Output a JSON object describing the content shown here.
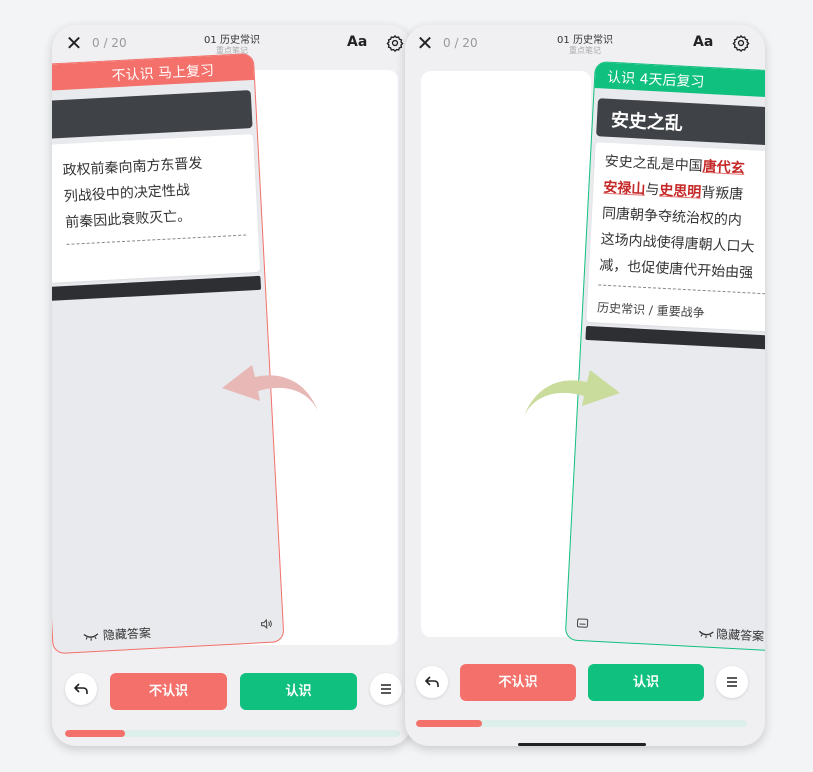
{
  "screens": [
    {
      "topbar": {
        "close_icon": "close-icon",
        "counter": "0 / 20",
        "deck_title": "01 历史常识",
        "deck_subtitle": "重点笔记",
        "font_label": "Aa",
        "settings_icon": "gear-icon"
      },
      "card": {
        "status": "不认识 马上复习",
        "accent_color": "#f4706a",
        "term": "",
        "definition_lines": [
          "政权前秦向南方东晋发",
          "列战役中的决定性战",
          "前秦因此衰败灭亡。"
        ],
        "hide_answer_label": "隐藏答案",
        "hide_icon": "closed-eye-icon",
        "sound_icon": "speaker-icon"
      },
      "swipe_icon": "swipe-left-arrow-icon",
      "bottom": {
        "undo_icon": "undo-icon",
        "unknown_label": "不认识",
        "known_label": "认识",
        "menu_icon": "menu-icon",
        "progress": 0.18
      }
    },
    {
      "topbar": {
        "close_icon": "close-icon",
        "counter": "0 / 20",
        "deck_title": "01 历史常识",
        "deck_subtitle": "重点笔记",
        "font_label": "Aa",
        "settings_icon": "gear-icon"
      },
      "card": {
        "status": "认识 4天后复习",
        "accent_color": "#10c07f",
        "term": "安史之乱",
        "definition": {
          "line1_prefix": "安史之乱是中国",
          "line1_highlight": "唐代玄",
          "line2_hl1": "安禄山",
          "line2_mid": "与",
          "line2_hl2": "史思明",
          "line2_suffix": "背叛唐",
          "line3": "同唐朝争夺统治权的内",
          "line4": "这场内战使得唐朝人口大",
          "line5": "减，也促使唐代开始由强"
        },
        "tag": "历史常识 / 重要战争",
        "hide_answer_label": "隐藏答案",
        "hide_icon": "closed-eye-icon",
        "card_icon": "card-icon"
      },
      "swipe_icon": "swipe-right-arrow-icon",
      "bottom": {
        "undo_icon": "undo-icon",
        "unknown_label": "不认识",
        "known_label": "认识",
        "menu_icon": "menu-icon",
        "progress": 0.2
      }
    }
  ]
}
